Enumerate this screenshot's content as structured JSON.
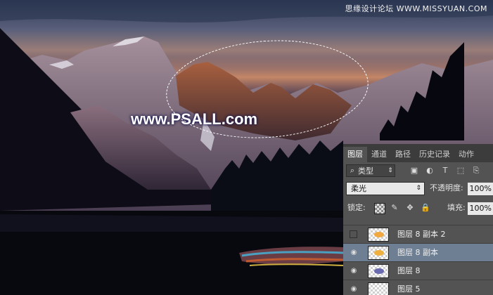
{
  "watermark": {
    "site_cn": "思缘设计论坛 WWW.MISSYUAN.COM",
    "psall": "www.PSALL.com"
  },
  "panel": {
    "tabs": [
      {
        "label": "图层",
        "active": true
      },
      {
        "label": "通道",
        "active": false
      },
      {
        "label": "路径",
        "active": false
      },
      {
        "label": "历史记录",
        "active": false
      },
      {
        "label": "动作",
        "active": false
      }
    ],
    "filter": {
      "label": "类型",
      "icon": "search-icon"
    },
    "filter_icons": [
      "image-filter-icon",
      "adjustment-filter-icon",
      "type-filter-icon",
      "shape-filter-icon",
      "smart-object-filter-icon"
    ],
    "blend_mode": "柔光",
    "opacity_label": "不透明度:",
    "opacity_value": "100%",
    "lock_label": "锁定:",
    "fill_label": "填充:",
    "fill_value": "100%",
    "layers": [
      {
        "name": "图层 8 副本 2",
        "visible": false,
        "selected": false,
        "thumb_color": "#f2a840"
      },
      {
        "name": "图层 8 副本",
        "visible": true,
        "selected": true,
        "thumb_color": "#f0b040"
      },
      {
        "name": "图层 8",
        "visible": true,
        "selected": false,
        "thumb_color": "#6a6ab0"
      },
      {
        "name": "图层 5",
        "visible": true,
        "selected": false,
        "thumb_color": "#ffffff"
      }
    ]
  },
  "colors": {
    "panel_bg": "#535353",
    "tab_bar_bg": "#3c3c3c",
    "selected_layer": "#6f7f93"
  }
}
